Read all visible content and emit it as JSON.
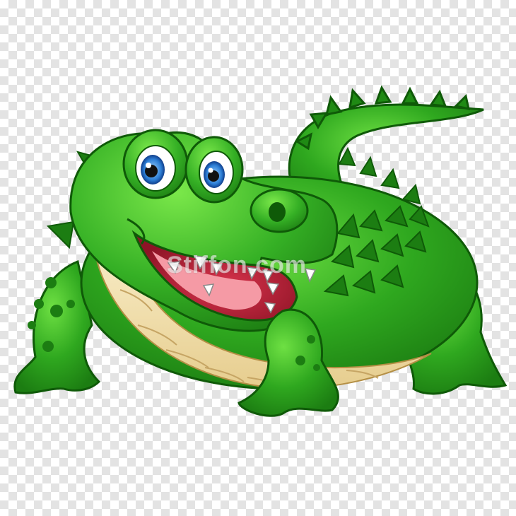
{
  "image": {
    "subject": "cartoon-crocodile",
    "background": "transparency-checkerboard",
    "watermark_text": "Stiffon.com"
  },
  "colors": {
    "body_green": "#2fa81f",
    "body_light": "#5fd43a",
    "body_dark": "#1c7d12",
    "outline": "#0f5a08",
    "belly": "#f4e3b0",
    "belly_shadow": "#d9bd7c",
    "mouth": "#c0243a",
    "tongue": "#f59aa5",
    "eye_iris": "#2d7fd6",
    "checker": "#e3e3e3"
  }
}
